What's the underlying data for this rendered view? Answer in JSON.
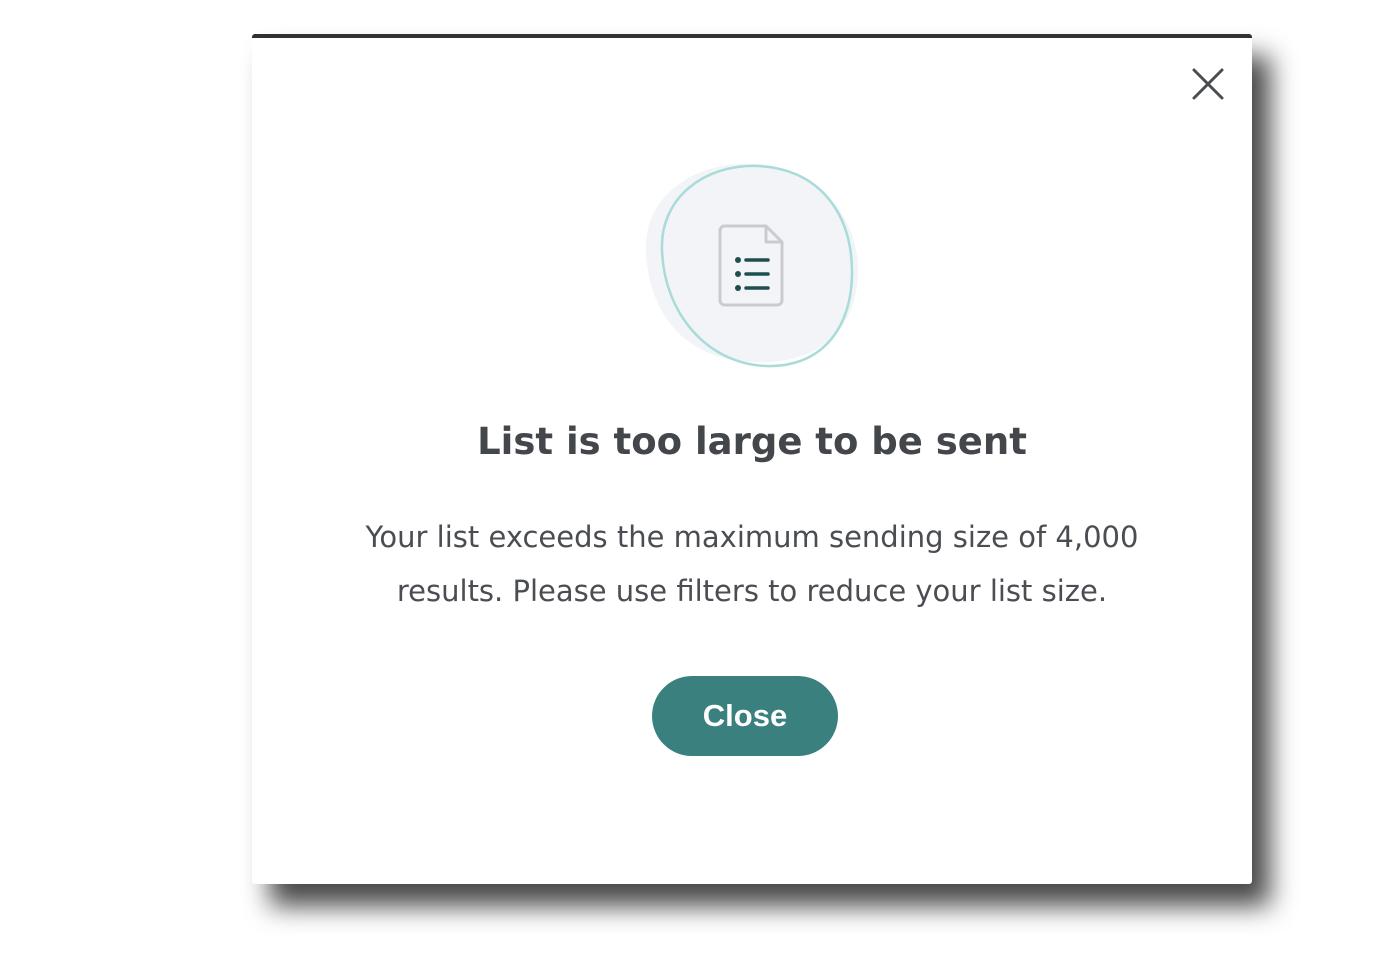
{
  "dialog": {
    "title": "List is too large to be sent",
    "message": "Your list exceeds the maximum sending size of 4,000 results. Please use filters to reduce your list size.",
    "close_button_label": "Close",
    "close_icon": "close-icon",
    "illustration_icon": "document-list-icon"
  },
  "colors": {
    "accent": "#3a807f",
    "title_text": "#43464b",
    "body_text": "#4a4d52",
    "blob_fill": "#f3f4f8",
    "blob_stroke": "#a9dbd8",
    "icon_line": "#1f4e4f"
  }
}
